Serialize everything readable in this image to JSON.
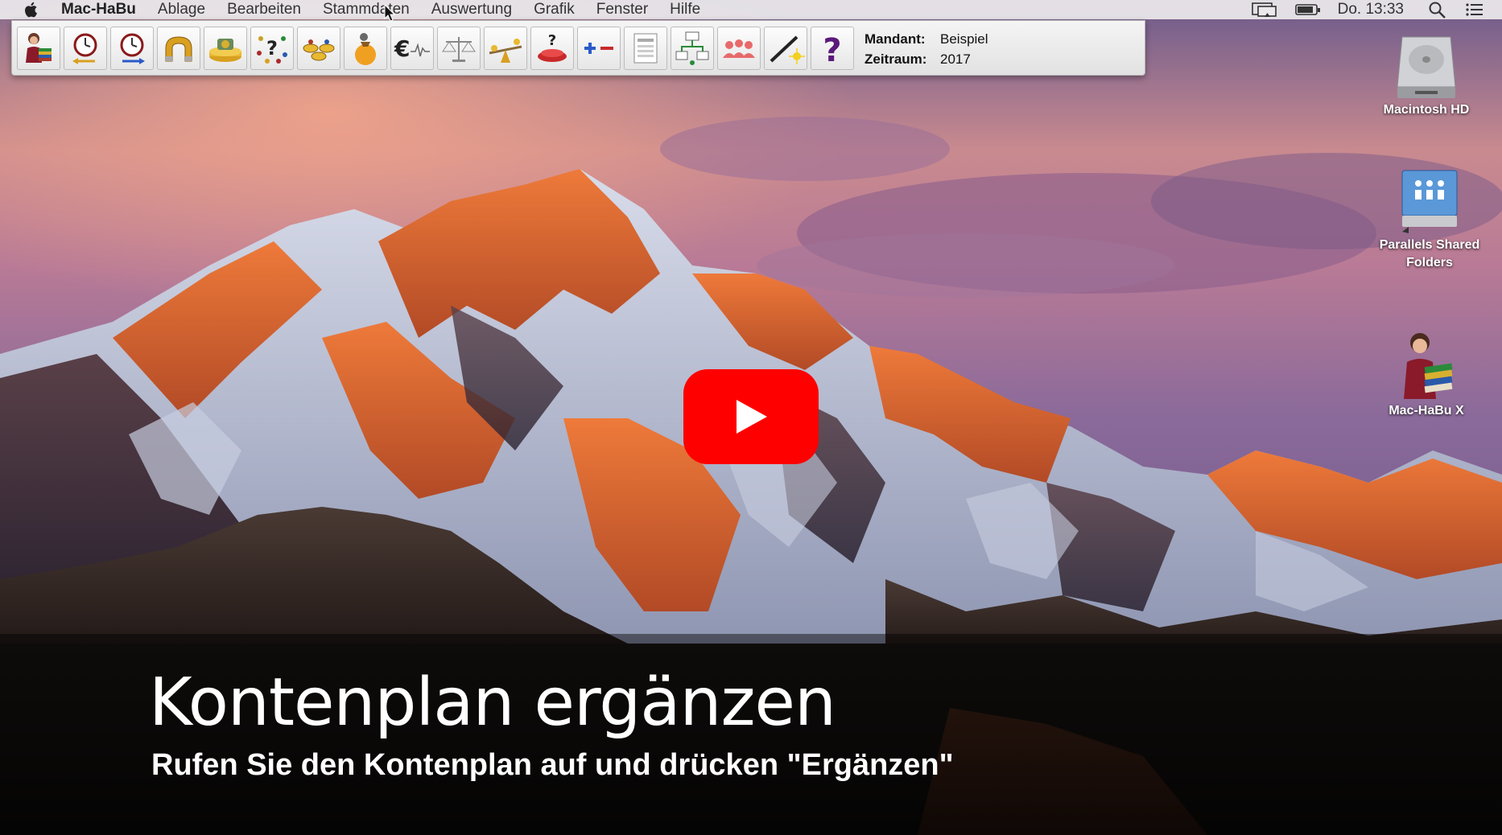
{
  "menubar": {
    "app_name": "Mac-HaBu",
    "items": [
      {
        "label": "Ablage"
      },
      {
        "label": "Bearbeiten"
      },
      {
        "label": "Stammdaten"
      },
      {
        "label": "Auswertung"
      },
      {
        "label": "Grafik"
      },
      {
        "label": "Fenster"
      },
      {
        "label": "Hilfe"
      }
    ],
    "clock": "Do. 13:33",
    "icons": [
      "apple-icon",
      "display-mirroring-icon",
      "battery-icon",
      "spotlight-search-icon",
      "notification-center-icon"
    ]
  },
  "toolbar": {
    "buttons": [
      {
        "icon": "user-books-icon"
      },
      {
        "icon": "clock-back-icon"
      },
      {
        "icon": "clock-forward-icon"
      },
      {
        "icon": "magnet-icon"
      },
      {
        "icon": "money-tray-icon"
      },
      {
        "icon": "question-dots-icon"
      },
      {
        "icon": "coins-icon"
      },
      {
        "icon": "money-bag-icon"
      },
      {
        "icon": "euro-curve-icon"
      },
      {
        "icon": "scale-balance-icon"
      },
      {
        "icon": "seesaw-icon"
      },
      {
        "icon": "question-stamp-icon"
      },
      {
        "icon": "plus-minus-icon"
      },
      {
        "icon": "form-list-icon"
      },
      {
        "icon": "flowchart-icon"
      },
      {
        "icon": "people-group-icon"
      },
      {
        "icon": "magic-wand-icon"
      },
      {
        "icon": "help-question-icon"
      }
    ],
    "mandant_label": "Mandant:",
    "mandant_value": "Beispiel",
    "zeitraum_label": "Zeitraum:",
    "zeitraum_value": "2017"
  },
  "desktop_icons": [
    {
      "label": "Macintosh HD",
      "icon": "hard-drive-icon"
    },
    {
      "label_line1": "Parallels Shared",
      "label_line2": "Folders",
      "icon": "shared-folders-icon"
    },
    {
      "label": "Mac-HaBu X",
      "icon": "mac-habu-app-icon"
    }
  ],
  "video": {
    "play_icon": "youtube-play-icon",
    "play_color": "#ff0000",
    "title": "Kontenplan ergänzen",
    "subtitle": "Rufen Sie den Kontenplan auf und drücken \"Ergänzen\""
  }
}
